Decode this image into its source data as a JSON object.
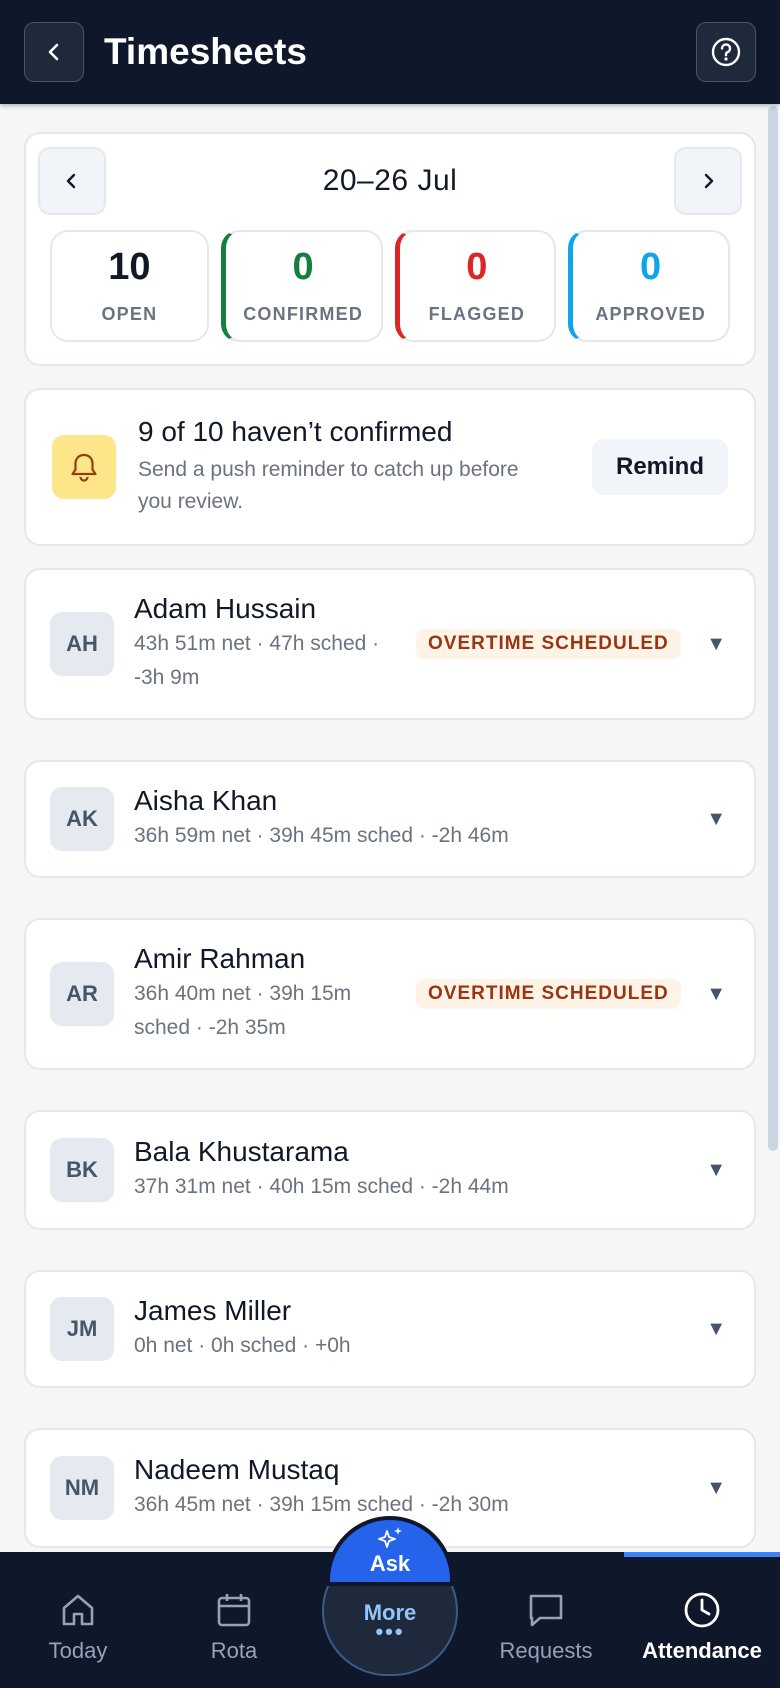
{
  "header": {
    "title": "Timesheets",
    "back_icon": "chevron-left-icon",
    "help_icon": "help-circle-icon"
  },
  "week": {
    "label": "20–26 Jul",
    "stats": [
      {
        "value": "10",
        "label": "OPEN",
        "color": "#111827"
      },
      {
        "value": "0",
        "label": "CONFIRMED",
        "color": "#15803d"
      },
      {
        "value": "0",
        "label": "FLAGGED",
        "color": "#dc2626"
      },
      {
        "value": "0",
        "label": "APPROVED",
        "color": "#0ea5e9"
      }
    ]
  },
  "reminder": {
    "title": "9 of 10 haven’t confirmed",
    "subtitle": "Send a push reminder to catch up before you review.",
    "button": "Remind"
  },
  "employees": [
    {
      "initials": "AH",
      "name": "Adam Hussain",
      "meta": "43h 51m net · 47h sched · -3h 9m",
      "badge": "OVERTIME SCHEDULED"
    },
    {
      "initials": "AK",
      "name": "Aisha Khan",
      "meta": "36h 59m net · 39h 45m sched · -2h 46m",
      "badge": ""
    },
    {
      "initials": "AR",
      "name": "Amir Rahman",
      "meta": "36h 40m net · 39h 15m sched · -2h 35m",
      "badge": "OVERTIME SCHEDULED"
    },
    {
      "initials": "BK",
      "name": "Bala Khustarama",
      "meta": "37h 31m net · 40h 15m sched · -2h 44m",
      "badge": ""
    },
    {
      "initials": "JM",
      "name": "James Miller",
      "meta": "0h net · 0h sched · +0h",
      "badge": ""
    },
    {
      "initials": "NM",
      "name": "Nadeem Mustaq",
      "meta": "36h 45m net · 39h 15m sched · -2h 30m",
      "badge": ""
    }
  ],
  "nav": {
    "today": "Today",
    "rota": "Rota",
    "ask": "Ask",
    "more": "More",
    "requests": "Requests",
    "attendance": "Attendance"
  }
}
